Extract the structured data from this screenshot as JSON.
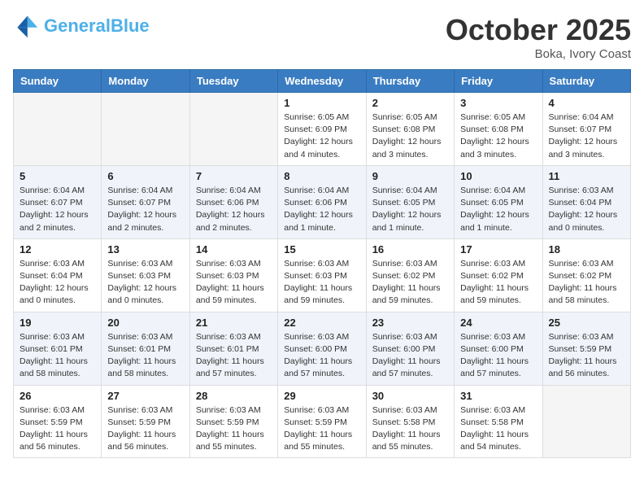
{
  "header": {
    "logo_text1": "General",
    "logo_text2": "Blue",
    "month": "October 2025",
    "location": "Boka, Ivory Coast"
  },
  "days_of_week": [
    "Sunday",
    "Monday",
    "Tuesday",
    "Wednesday",
    "Thursday",
    "Friday",
    "Saturday"
  ],
  "weeks": [
    [
      {
        "day": "",
        "info": ""
      },
      {
        "day": "",
        "info": ""
      },
      {
        "day": "",
        "info": ""
      },
      {
        "day": "1",
        "info": "Sunrise: 6:05 AM\nSunset: 6:09 PM\nDaylight: 12 hours\nand 4 minutes."
      },
      {
        "day": "2",
        "info": "Sunrise: 6:05 AM\nSunset: 6:08 PM\nDaylight: 12 hours\nand 3 minutes."
      },
      {
        "day": "3",
        "info": "Sunrise: 6:05 AM\nSunset: 6:08 PM\nDaylight: 12 hours\nand 3 minutes."
      },
      {
        "day": "4",
        "info": "Sunrise: 6:04 AM\nSunset: 6:07 PM\nDaylight: 12 hours\nand 3 minutes."
      }
    ],
    [
      {
        "day": "5",
        "info": "Sunrise: 6:04 AM\nSunset: 6:07 PM\nDaylight: 12 hours\nand 2 minutes."
      },
      {
        "day": "6",
        "info": "Sunrise: 6:04 AM\nSunset: 6:07 PM\nDaylight: 12 hours\nand 2 minutes."
      },
      {
        "day": "7",
        "info": "Sunrise: 6:04 AM\nSunset: 6:06 PM\nDaylight: 12 hours\nand 2 minutes."
      },
      {
        "day": "8",
        "info": "Sunrise: 6:04 AM\nSunset: 6:06 PM\nDaylight: 12 hours\nand 1 minute."
      },
      {
        "day": "9",
        "info": "Sunrise: 6:04 AM\nSunset: 6:05 PM\nDaylight: 12 hours\nand 1 minute."
      },
      {
        "day": "10",
        "info": "Sunrise: 6:04 AM\nSunset: 6:05 PM\nDaylight: 12 hours\nand 1 minute."
      },
      {
        "day": "11",
        "info": "Sunrise: 6:03 AM\nSunset: 6:04 PM\nDaylight: 12 hours\nand 0 minutes."
      }
    ],
    [
      {
        "day": "12",
        "info": "Sunrise: 6:03 AM\nSunset: 6:04 PM\nDaylight: 12 hours\nand 0 minutes."
      },
      {
        "day": "13",
        "info": "Sunrise: 6:03 AM\nSunset: 6:03 PM\nDaylight: 12 hours\nand 0 minutes."
      },
      {
        "day": "14",
        "info": "Sunrise: 6:03 AM\nSunset: 6:03 PM\nDaylight: 11 hours\nand 59 minutes."
      },
      {
        "day": "15",
        "info": "Sunrise: 6:03 AM\nSunset: 6:03 PM\nDaylight: 11 hours\nand 59 minutes."
      },
      {
        "day": "16",
        "info": "Sunrise: 6:03 AM\nSunset: 6:02 PM\nDaylight: 11 hours\nand 59 minutes."
      },
      {
        "day": "17",
        "info": "Sunrise: 6:03 AM\nSunset: 6:02 PM\nDaylight: 11 hours\nand 59 minutes."
      },
      {
        "day": "18",
        "info": "Sunrise: 6:03 AM\nSunset: 6:02 PM\nDaylight: 11 hours\nand 58 minutes."
      }
    ],
    [
      {
        "day": "19",
        "info": "Sunrise: 6:03 AM\nSunset: 6:01 PM\nDaylight: 11 hours\nand 58 minutes."
      },
      {
        "day": "20",
        "info": "Sunrise: 6:03 AM\nSunset: 6:01 PM\nDaylight: 11 hours\nand 58 minutes."
      },
      {
        "day": "21",
        "info": "Sunrise: 6:03 AM\nSunset: 6:01 PM\nDaylight: 11 hours\nand 57 minutes."
      },
      {
        "day": "22",
        "info": "Sunrise: 6:03 AM\nSunset: 6:00 PM\nDaylight: 11 hours\nand 57 minutes."
      },
      {
        "day": "23",
        "info": "Sunrise: 6:03 AM\nSunset: 6:00 PM\nDaylight: 11 hours\nand 57 minutes."
      },
      {
        "day": "24",
        "info": "Sunrise: 6:03 AM\nSunset: 6:00 PM\nDaylight: 11 hours\nand 57 minutes."
      },
      {
        "day": "25",
        "info": "Sunrise: 6:03 AM\nSunset: 5:59 PM\nDaylight: 11 hours\nand 56 minutes."
      }
    ],
    [
      {
        "day": "26",
        "info": "Sunrise: 6:03 AM\nSunset: 5:59 PM\nDaylight: 11 hours\nand 56 minutes."
      },
      {
        "day": "27",
        "info": "Sunrise: 6:03 AM\nSunset: 5:59 PM\nDaylight: 11 hours\nand 56 minutes."
      },
      {
        "day": "28",
        "info": "Sunrise: 6:03 AM\nSunset: 5:59 PM\nDaylight: 11 hours\nand 55 minutes."
      },
      {
        "day": "29",
        "info": "Sunrise: 6:03 AM\nSunset: 5:59 PM\nDaylight: 11 hours\nand 55 minutes."
      },
      {
        "day": "30",
        "info": "Sunrise: 6:03 AM\nSunset: 5:58 PM\nDaylight: 11 hours\nand 55 minutes."
      },
      {
        "day": "31",
        "info": "Sunrise: 6:03 AM\nSunset: 5:58 PM\nDaylight: 11 hours\nand 54 minutes."
      },
      {
        "day": "",
        "info": ""
      }
    ]
  ]
}
